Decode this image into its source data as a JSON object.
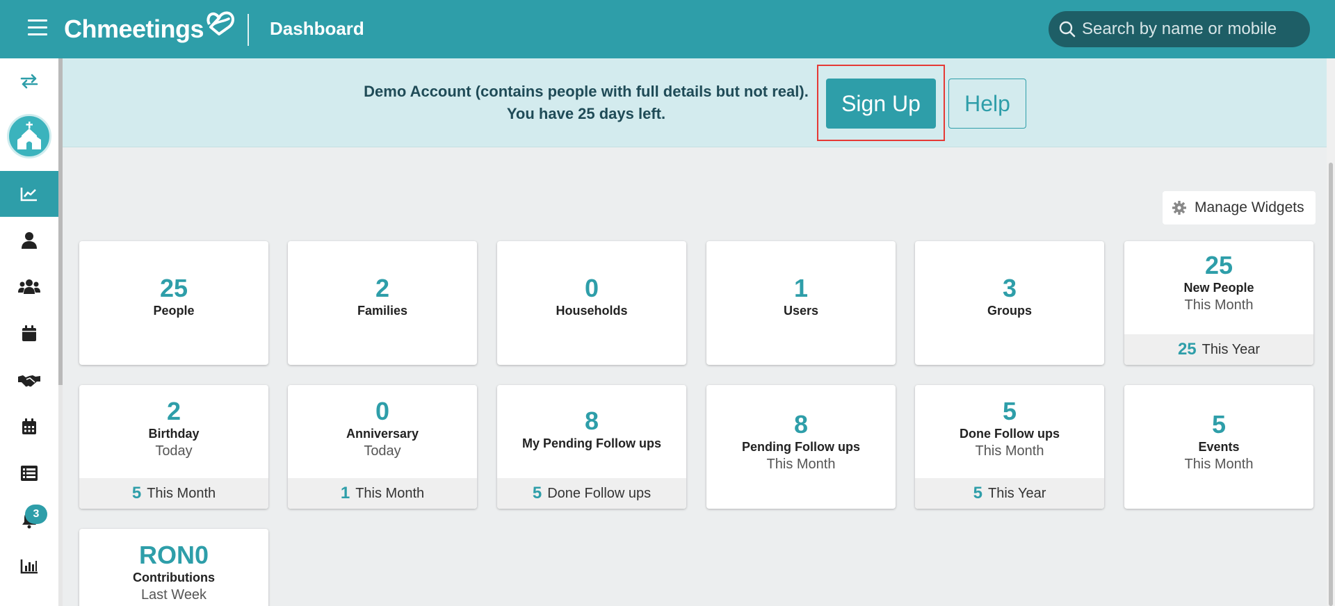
{
  "header": {
    "brand": "Chmeetings",
    "title": "Dashboard",
    "search_placeholder": "Search by name or mobile"
  },
  "sidebar": {
    "items": [
      {
        "icon": "swap-icon"
      },
      {
        "icon": "church-icon"
      },
      {
        "icon": "chart-icon",
        "active": true
      },
      {
        "icon": "person-icon"
      },
      {
        "icon": "group-icon"
      },
      {
        "icon": "calendar-icon"
      },
      {
        "icon": "handshake-icon"
      },
      {
        "icon": "calendar-grid-icon"
      },
      {
        "icon": "list-icon"
      },
      {
        "icon": "bell-icon"
      },
      {
        "icon": "bar-chart-icon"
      }
    ],
    "notification_count": "3"
  },
  "banner": {
    "line1": "Demo Account (contains people with full details but not real).",
    "line2": "You have 25 days left.",
    "signup_label": "Sign Up",
    "help_label": "Help"
  },
  "manage_widgets_label": "Manage Widgets",
  "colors": {
    "accent": "#2e9ea9",
    "topbar": "#2e9ea9",
    "highlight": "#e53935"
  },
  "widgets": [
    {
      "value": "25",
      "label": "People"
    },
    {
      "value": "2",
      "label": "Families"
    },
    {
      "value": "0",
      "label": "Households"
    },
    {
      "value": "1",
      "label": "Users"
    },
    {
      "value": "3",
      "label": "Groups"
    },
    {
      "value": "25",
      "label": "New People",
      "sub": "This Month",
      "foot_value": "25",
      "foot_label": "This Year"
    },
    {
      "value": "2",
      "label": "Birthday",
      "sub": "Today",
      "foot_value": "5",
      "foot_label": "This Month"
    },
    {
      "value": "0",
      "label": "Anniversary",
      "sub": "Today",
      "foot_value": "1",
      "foot_label": "This Month"
    },
    {
      "value": "8",
      "label": "My Pending Follow ups",
      "foot_value": "5",
      "foot_label": "Done Follow ups"
    },
    {
      "value": "8",
      "label": "Pending Follow ups",
      "sub": "This Month"
    },
    {
      "value": "5",
      "label": "Done Follow ups",
      "sub": "This Month",
      "foot_value": "5",
      "foot_label": "This Year"
    },
    {
      "value": "5",
      "label": "Events",
      "sub": "This Month"
    },
    {
      "value": "RON0",
      "label": "Contributions",
      "sub": "Last Week"
    }
  ]
}
